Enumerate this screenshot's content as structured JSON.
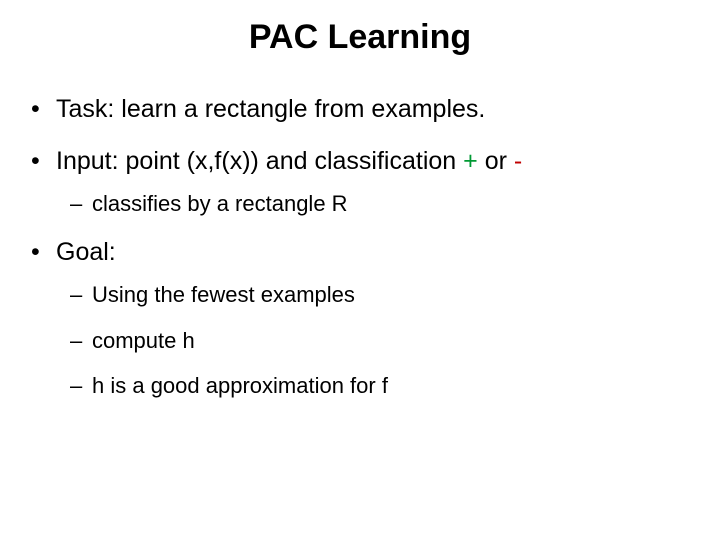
{
  "title": "PAC Learning",
  "bullets": {
    "task": {
      "label": "Task:",
      "text": " learn a rectangle from examples."
    },
    "input": {
      "label": "Input:",
      "text": " point (x,f(x)) and classification ",
      "plus": "+",
      "mid": " or ",
      "minus": "-",
      "sub": {
        "classifies": "classifies by a rectangle R"
      }
    },
    "goal": {
      "label": "Goal:",
      "sub": {
        "fewest": "Using the fewest examples",
        "compute": "compute h",
        "approx": "h is a good approximation for f"
      }
    }
  }
}
